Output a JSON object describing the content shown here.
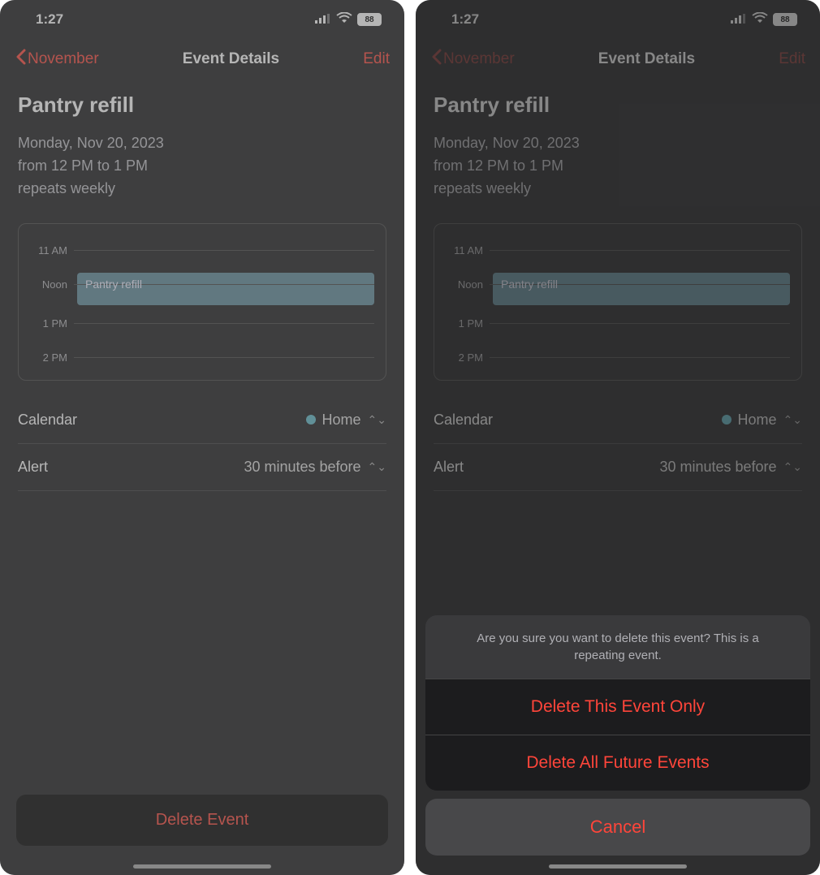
{
  "status": {
    "time": "1:27",
    "battery": "88"
  },
  "nav": {
    "back": "November",
    "title": "Event Details",
    "edit": "Edit"
  },
  "event": {
    "title": "Pantry refill",
    "date": "Monday, Nov 20, 2023",
    "time_range": "from 12 PM to 1 PM",
    "repeats": "repeats weekly"
  },
  "timeline": {
    "hours": [
      "11 AM",
      "Noon",
      "1 PM",
      "2 PM"
    ],
    "block_label": "Pantry refill"
  },
  "rows": {
    "calendar_label": "Calendar",
    "calendar_value": "Home",
    "alert_label": "Alert",
    "alert_value": "30 minutes before"
  },
  "delete_button": "Delete Event",
  "sheet": {
    "message": "Are you sure you want to delete this event? This is a repeating event.",
    "option1": "Delete This Event Only",
    "option2": "Delete All Future Events",
    "cancel": "Cancel"
  }
}
